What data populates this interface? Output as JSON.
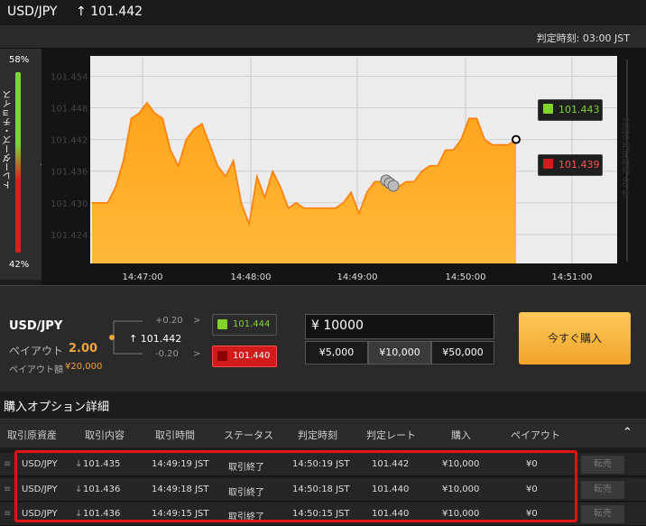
{
  "header": {
    "pair": "USD/JPY",
    "arrow": "↑",
    "price": "101.442"
  },
  "subheader": {
    "expiry_label": "判定時刻:",
    "expiry_time": "03:00 JST"
  },
  "sentiment": {
    "top_pct": "58%",
    "bottom_pct": "42%",
    "label": "トレーダーズ・チョイス",
    "arrow": "‹"
  },
  "chart_data": {
    "type": "area",
    "y_ticks": [
      "101.454",
      "101.448",
      "101.442",
      "101.436",
      "101.430",
      "101.424"
    ],
    "x_ticks": [
      "14:47:00",
      "14:48:00",
      "14:49:00",
      "14:50:00",
      "14:51:00"
    ],
    "up_value": "101.443",
    "down_value": "101.439",
    "right_label": "次回の判定時刻 60 秒",
    "series": [
      101.43,
      101.43,
      101.43,
      101.433,
      101.438,
      101.446,
      101.447,
      101.449,
      101.447,
      101.446,
      101.44,
      101.437,
      101.442,
      101.444,
      101.445,
      101.441,
      101.437,
      101.435,
      101.438,
      101.43,
      101.426,
      101.435,
      101.431,
      101.436,
      101.433,
      101.429,
      101.43,
      101.429,
      101.429,
      101.429,
      101.429,
      101.429,
      101.43,
      101.432,
      101.428,
      101.432,
      101.434,
      101.434,
      101.434,
      101.433,
      101.434,
      101.434,
      101.436,
      101.437,
      101.437,
      101.44,
      101.44,
      101.442,
      101.446,
      101.446,
      101.442,
      101.441,
      101.441,
      101.441,
      101.442
    ]
  },
  "trade": {
    "pair": "USD/JPY",
    "payout_label": "ペイアウト",
    "payout_value": "2.00",
    "payout_amount_label": "ペイアウト額",
    "payout_amount": "¥20,000",
    "plus_offset": "+0.20",
    "minus_offset": "-0.20",
    "current_arrow": "↑",
    "current_price": "101.442",
    "up_price": "101.444",
    "down_price": "101.440",
    "amount": "¥ 10000",
    "presets": [
      "¥5,000",
      "¥10,000",
      "¥50,000"
    ],
    "buy_label": "今すぐ購入"
  },
  "details": {
    "title": "購入オプション詳細",
    "columns": [
      "取引原資産",
      "取引内容",
      "取引時間",
      "ステータス",
      "判定時刻",
      "判定レート",
      "購入",
      "ペイアウト"
    ],
    "rows": [
      {
        "asset": "USD/JPY",
        "dir": "↓",
        "rate": "101.435",
        "time": "14:49:19 JST",
        "status": "取引終了",
        "expiry": "14:50:19 JST",
        "expiry_rate": "101.442",
        "purchase": "¥10,000",
        "payout": "¥0"
      },
      {
        "asset": "USD/JPY",
        "dir": "↓",
        "rate": "101.436",
        "time": "14:49:18 JST",
        "status": "取引終了",
        "expiry": "14:50:18 JST",
        "expiry_rate": "101.440",
        "purchase": "¥10,000",
        "payout": "¥0"
      },
      {
        "asset": "USD/JPY",
        "dir": "↓",
        "rate": "101.436",
        "time": "14:49:15 JST",
        "status": "取引終了",
        "expiry": "14:50:15 JST",
        "expiry_rate": "101.440",
        "purchase": "¥10,000",
        "payout": "¥0"
      }
    ],
    "row_action": "転売",
    "collapse": "⌃"
  },
  "colors": {
    "accent": "#f0a53a",
    "up": "#82d428",
    "down": "#d11b1b",
    "frame": "#e21414"
  }
}
